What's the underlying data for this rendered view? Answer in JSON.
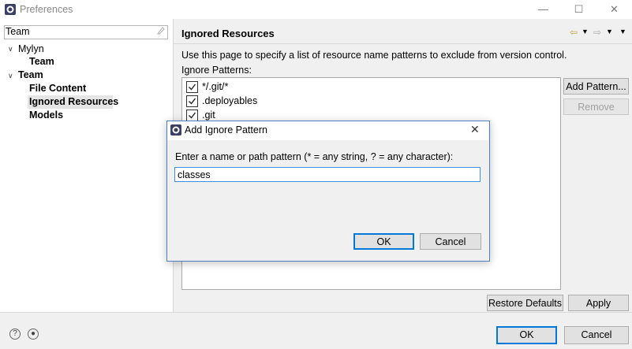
{
  "window": {
    "title": "Preferences",
    "minimize_icon": "minimize-icon",
    "maximize_icon": "maximize-icon",
    "close_icon": "close-icon"
  },
  "sidebar": {
    "filter_value": "Team",
    "tree": [
      {
        "label": "Mylyn",
        "expanded": true,
        "children": [
          "Team"
        ]
      },
      {
        "label": "Team",
        "expanded": true,
        "children": [
          "File Content",
          "Ignored Resources",
          "Models"
        ]
      }
    ],
    "selected": "Ignored Resources"
  },
  "page": {
    "title": "Ignored Resources",
    "description": "Use this page to specify a list of resource name patterns to exclude from version control.",
    "patterns_label": "Ignore Patterns:",
    "patterns": [
      {
        "label": "*/.git/*",
        "checked": true
      },
      {
        "label": ".deployables",
        "checked": true
      },
      {
        "label": ".git",
        "checked": true
      }
    ],
    "add_pattern_label": "Add Pattern...",
    "remove_label": "Remove",
    "restore_defaults_label": "Restore Defaults",
    "apply_label": "Apply"
  },
  "footer": {
    "ok_label": "OK",
    "cancel_label": "Cancel",
    "help_icon": "help-icon",
    "import_icon": "import-export-icon"
  },
  "dialog": {
    "title": "Add Ignore Pattern",
    "prompt": "Enter a name or path pattern (* = any string, ? = any character):",
    "input_value": "classes",
    "ok_label": "OK",
    "cancel_label": "Cancel"
  },
  "colors": {
    "accent": "#0078d7",
    "selection": "#e5e5e5"
  }
}
